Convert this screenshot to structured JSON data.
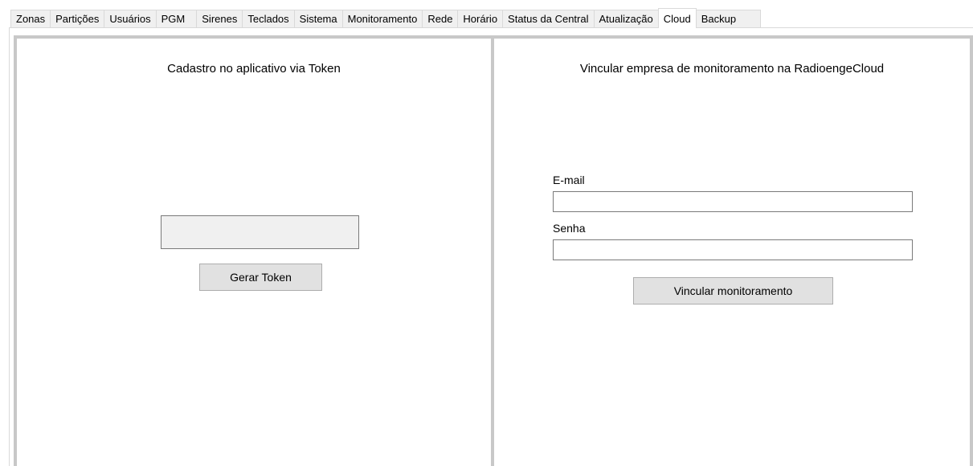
{
  "tabs": [
    {
      "label": "Zonas",
      "active": false
    },
    {
      "label": "Partições",
      "active": false
    },
    {
      "label": "Usuários",
      "active": false
    },
    {
      "label": "PGM",
      "active": false
    },
    {
      "label": "Sirenes",
      "active": false
    },
    {
      "label": "Teclados",
      "active": false
    },
    {
      "label": "Sistema",
      "active": false
    },
    {
      "label": "Monitoramento",
      "active": false
    },
    {
      "label": "Rede",
      "active": false
    },
    {
      "label": "Horário",
      "active": false
    },
    {
      "label": "Status da Central",
      "active": false
    },
    {
      "label": "Atualização",
      "active": false
    },
    {
      "label": "Cloud",
      "active": true
    },
    {
      "label": "Backup",
      "active": false
    }
  ],
  "token_panel": {
    "title": "Cadastro no aplicativo via Token",
    "token_value": "",
    "button_label": "Gerar Token"
  },
  "monitoring_panel": {
    "title": "Vincular empresa de monitoramento na RadioengeCloud",
    "email_label": "E-mail",
    "email_value": "",
    "password_label": "Senha",
    "password_value": "",
    "button_label": "Vincular monitoramento"
  },
  "colors": {
    "panel_border": "#c8c8c8",
    "button_bg": "#e1e1e1",
    "tab_bg": "#f0f0f0"
  }
}
